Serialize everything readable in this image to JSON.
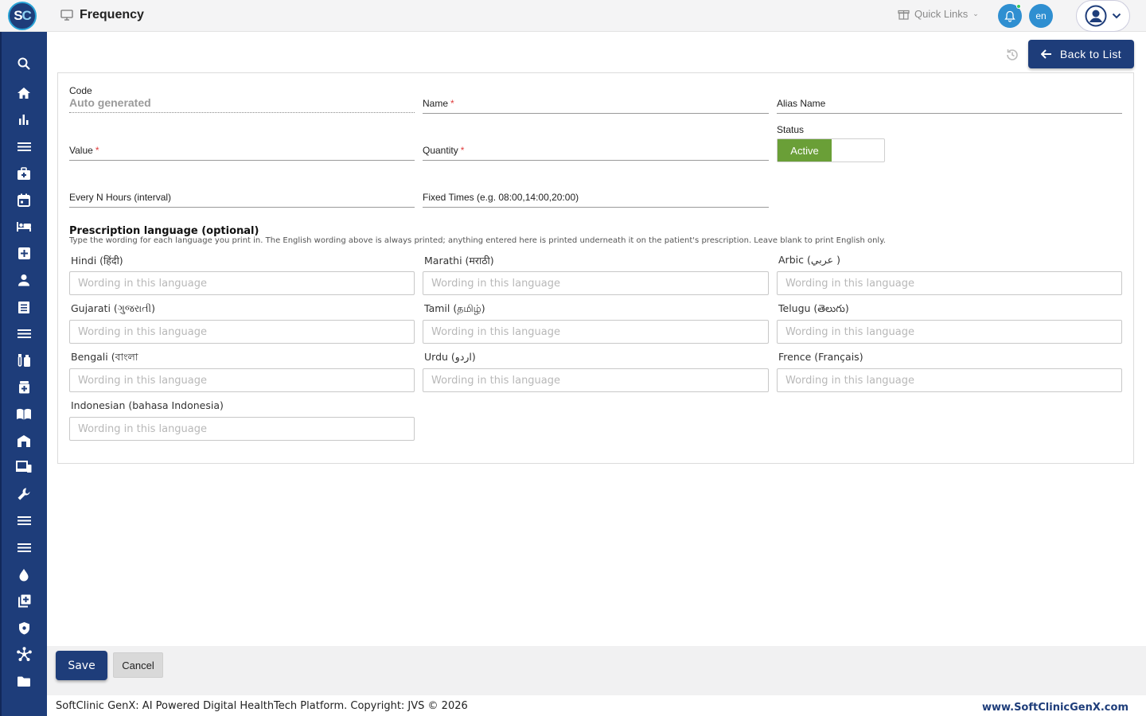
{
  "app": {
    "logo_left": "S",
    "logo_right": "C",
    "page_title": "Frequency"
  },
  "header": {
    "quick_links": "Quick Links",
    "language": "en"
  },
  "toolbar": {
    "back_label": "Back to List"
  },
  "form": {
    "code": {
      "label": "Code",
      "value": "Auto generated"
    },
    "name": {
      "label": "Name",
      "required": "*"
    },
    "alias": {
      "label": "Alias Name"
    },
    "value": {
      "label": "Value",
      "required": "*"
    },
    "quantity": {
      "label": "Quantity",
      "required": "*"
    },
    "status": {
      "label": "Status",
      "value": "Active"
    },
    "interval": {
      "label": "Every N Hours (interval)"
    },
    "fixed_times": {
      "label": "Fixed Times (e.g. 08:00,14:00,20:00)"
    }
  },
  "prescription_language": {
    "title": "Prescription language (optional)",
    "caret": "▲",
    "help": "Type the wording for each language you print in. The English wording above is always printed; anything entered here is printed underneath it on the patient's prescription. Leave blank to print English only.",
    "placeholder": "Wording in this language",
    "languages": [
      "Hindi (हिंदी)",
      "Marathi (मराठी)",
      "Arbic (عربي )",
      "Gujarati (ગુજરાતી)",
      "Tamil (தமிழ்)",
      "Telugu (తెలుగు)",
      "Bengali (বাংলা",
      "Urdu (اردو)",
      "Frence (Français)",
      "Indonesian (bahasa Indonesia)"
    ]
  },
  "actions": {
    "save": "Save",
    "cancel": "Cancel"
  },
  "footer": {
    "copyright": "SoftClinic GenX: AI Powered Digital HealthTech Platform. Copyright: JVS © 2026",
    "site": "www.SoftClinicGenX.com"
  },
  "sidebar_icons": [
    "search-icon",
    "home-icon",
    "bar-chart-icon",
    "menu-icon",
    "medical-bag-icon",
    "calendar-icon",
    "bed-icon",
    "hospital-plus-icon",
    "person-icon",
    "receipt-icon",
    "list-icon",
    "lab-icon",
    "medicine-icon",
    "book-icon",
    "store-icon",
    "devices-icon",
    "wrench-icon",
    "lines-icon",
    "lines-alt-icon",
    "drop-icon",
    "add-library-icon",
    "shield-icon",
    "network-icon",
    "folder-icon"
  ],
  "colors": {
    "brand": "#1e3d7a",
    "status_active": "#6a9f37",
    "notify": "#2f8fd1"
  }
}
